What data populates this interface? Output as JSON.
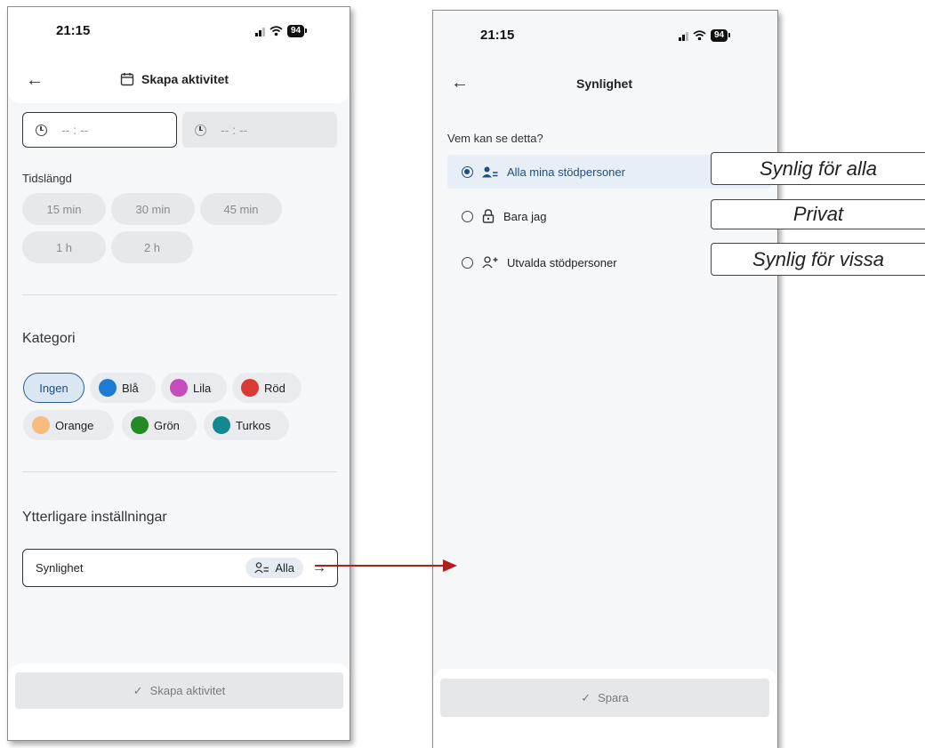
{
  "left_screen": {
    "status": {
      "time": "21:15",
      "battery": "94"
    },
    "header": {
      "title": "Skapa aktivitet"
    },
    "time_fields": {
      "start_placeholder": "-- : --",
      "end_placeholder": "-- : --"
    },
    "duration": {
      "label": "Tidslängd",
      "options": [
        "15 min",
        "30 min",
        "45 min",
        "1 h",
        "2 h"
      ]
    },
    "category": {
      "title": "Kategori",
      "selected": "Ingen",
      "items": [
        {
          "label": "Ingen",
          "color": ""
        },
        {
          "label": "Blå",
          "color": "#1f7ad4"
        },
        {
          "label": "Lila",
          "color": "#c64bbd"
        },
        {
          "label": "Röd",
          "color": "#d93a34"
        },
        {
          "label": "Orange",
          "color": "#f6bd7f"
        },
        {
          "label": "Grön",
          "color": "#248a23"
        },
        {
          "label": "Turkos",
          "color": "#138891"
        }
      ]
    },
    "more_settings": {
      "title": "Ytterligare inställningar",
      "visibility_label": "Synlighet",
      "visibility_value": "Alla"
    },
    "footer": {
      "submit_label": "Skapa aktivitet"
    }
  },
  "right_screen": {
    "status": {
      "time": "21:15",
      "battery": "94"
    },
    "header": {
      "title": "Synlighet"
    },
    "question": "Vem kan se detta?",
    "options": [
      {
        "label": "Alla mina stödpersoner",
        "selected": true,
        "icon": "people-icon"
      },
      {
        "label": "Bara jag",
        "selected": false,
        "icon": "lock-icon"
      },
      {
        "label": "Utvalda stödpersoner",
        "selected": false,
        "icon": "person-add-icon"
      }
    ],
    "footer": {
      "save_label": "Spara"
    }
  },
  "annotations": {
    "callouts": [
      "Synlig för alla",
      "Privat",
      "Synlig för vissa"
    ],
    "connector_color": "#b01e1e"
  }
}
